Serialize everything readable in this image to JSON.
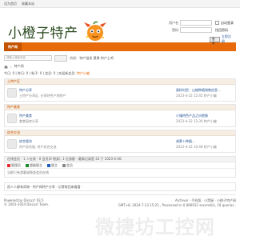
{
  "topbar": {
    "fav": "设为首页",
    "bookmark": "收藏本站"
  },
  "header": {
    "site_title": "小橙子特产"
  },
  "login": {
    "user_label": "用户名",
    "pass_label": "密码",
    "remember": "自动登录",
    "forgot": "找回密码",
    "login_btn": "登录",
    "register": "立即注册"
  },
  "nav": {
    "item": "特产网"
  },
  "search": {
    "placeholder": "请输入搜索内容",
    "hot_label": "热搜:",
    "hot_items": "特产批发 黄果 特产土鸡"
  },
  "breadcrumb": {
    "home": "特产网"
  },
  "subline": {
    "prefix": "今日: 0 | 昨日: 0 | 帖子: 0 | 会员: 0 | 欢迎新会员:",
    "new_member": "特产小编"
  },
  "categories": [
    {
      "head": "土特产区",
      "name": "特产分享",
      "desc": "土特产分享区, 分享特色产地特产",
      "last_title": "梨树村民：山楂种植销售信息…",
      "last_meta": "2023-4-22 12:45 特产小编"
    },
    {
      "head": "特产美食",
      "name": "特产美食",
      "desc": "美食厨房分享",
      "last_title": "小镇特色产品之炒肥肠",
      "last_meta": "2023-4-22 12:30 特产小编"
    },
    {
      "head": "综合交流",
      "name": "综合版块",
      "desc": "特产综合版, 特产综合交流",
      "last_title": "胡萝卜种植…",
      "last_meta": "2023-4-22 10:48 特产小编"
    }
  ],
  "stats": {
    "head": "在线会员 - 1 人在线 - 0 会员(0 隐身), 1 位游客 - 最高记录是 33 于 2023-4-26.",
    "legend": [
      "管理员",
      "超级版主",
      "版主",
      "会员"
    ],
    "users_note": "当前只有游客或隐身会员在线",
    "legend_colors": [
      "#e62d2d",
      "#1d8c2c",
      "#1d5bbf",
      "#888888"
    ]
  },
  "shortcut": {
    "text": "愿人人都有奇物 · 特产网特产分享 · 记得常回来看看 ·"
  },
  "footer": {
    "powered_by": "Powered by Discuz! X3.5",
    "copyright": "© 2001-2024 Discuz! Team.",
    "links": "Archiver · 手机版 · 小黑屋 · 小橙子特产网",
    "gmt": "GMT+8, 2024-7-13 15:21 , Processed in 0.066912 second(s), 19 queries ."
  },
  "watermark": {
    "text": "微捷坊工控网"
  },
  "colors": {
    "accent": "#e76b0a",
    "accent_dark": "#c45300",
    "title_green": "#2b4a1f",
    "link_blue": "#1f4f8f"
  }
}
